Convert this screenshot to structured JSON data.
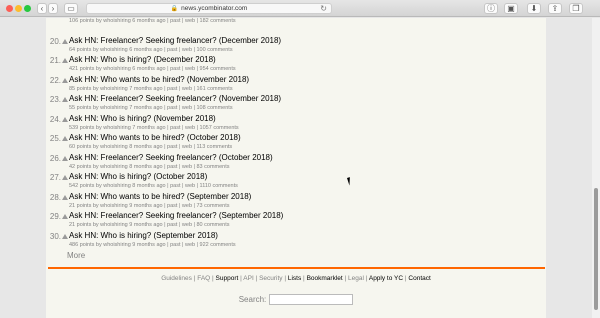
{
  "browser": {
    "url": "news.ycombinator.com"
  },
  "stories": [
    {
      "rank": "",
      "title": "",
      "sub": "106 points by whoishiring 6 months ago | past | web | 182 comments"
    },
    {
      "rank": "20.",
      "title": "Ask HN: Freelancer? Seeking freelancer? (December 2018)",
      "sub": "64 points by whoishiring 6 months ago | past | web | 100 comments"
    },
    {
      "rank": "21.",
      "title": "Ask HN: Who is hiring? (December 2018)",
      "sub": "421 points by whoishiring 6 months ago | past | web | 954 comments"
    },
    {
      "rank": "22.",
      "title": "Ask HN: Who wants to be hired? (November 2018)",
      "sub": "85 points by whoishiring 7 months ago | past | web | 161 comments"
    },
    {
      "rank": "23.",
      "title": "Ask HN: Freelancer? Seeking freelancer? (November 2018)",
      "sub": "55 points by whoishiring 7 months ago | past | web | 108 comments"
    },
    {
      "rank": "24.",
      "title": "Ask HN: Who is hiring? (November 2018)",
      "sub": "539 points by whoishiring 7 months ago | past | web | 1057 comments"
    },
    {
      "rank": "25.",
      "title": "Ask HN: Who wants to be hired? (October 2018)",
      "sub": "60 points by whoishiring 8 months ago | past | web | 113 comments"
    },
    {
      "rank": "26.",
      "title": "Ask HN: Freelancer? Seeking freelancer? (October 2018)",
      "sub": "42 points by whoishiring 8 months ago | past | web | 83 comments"
    },
    {
      "rank": "27.",
      "title": "Ask HN: Who is hiring? (October 2018)",
      "sub": "542 points by whoishiring 8 months ago | past | web | 1110 comments"
    },
    {
      "rank": "28.",
      "title": "Ask HN: Who wants to be hired? (September 2018)",
      "sub": "21 points by whoishiring 9 months ago | past | web | 73 comments"
    },
    {
      "rank": "29.",
      "title": "Ask HN: Freelancer? Seeking freelancer? (September 2018)",
      "sub": "21 points by whoishiring 9 months ago | past | web | 80 comments"
    },
    {
      "rank": "30.",
      "title": "Ask HN: Who is hiring? (September 2018)",
      "sub": "486 points by whoishiring 9 months ago | past | web | 922 comments"
    }
  ],
  "more_label": "More",
  "footer": {
    "links": [
      {
        "label": "Guidelines",
        "bold": false
      },
      {
        "label": "FAQ",
        "bold": false
      },
      {
        "label": "Support",
        "bold": true
      },
      {
        "label": "API",
        "bold": false
      },
      {
        "label": "Security",
        "bold": false
      },
      {
        "label": "Lists",
        "bold": true
      },
      {
        "label": "Bookmarklet",
        "bold": true
      },
      {
        "label": "Legal",
        "bold": false
      },
      {
        "label": "Apply to YC",
        "bold": true
      },
      {
        "label": "Contact",
        "bold": true
      }
    ],
    "search_label": "Search:",
    "search_value": ""
  },
  "colors": {
    "accent": "#ff6600",
    "page_bg": "#f6f6ef",
    "subtext": "#828282"
  }
}
